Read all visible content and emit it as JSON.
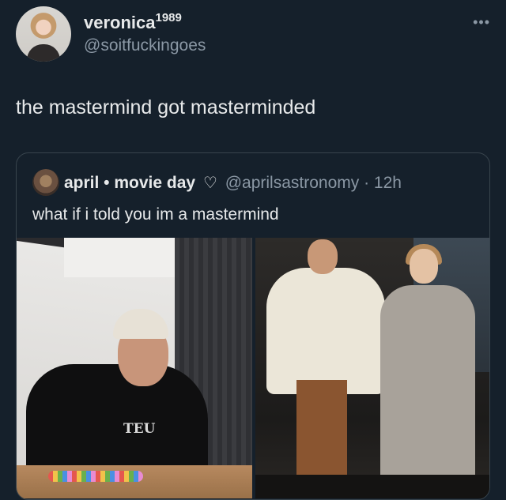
{
  "tweet": {
    "display_name": "veronica",
    "display_name_sup": "1989",
    "handle": "@soitfuckingoes",
    "more_icon": "more-horizontal-icon",
    "text": "the mastermind got masterminded"
  },
  "quoted": {
    "display_name": "april • movie day",
    "heart_icon": "heart-outline-icon",
    "handle_time": "@aprilsastronomy · 12h",
    "text": "what if i told you im a mastermind",
    "photo_labels": {
      "shirt_text": "TEU"
    }
  },
  "colors": {
    "background": "#15202b",
    "primary_text": "#e7e9ea",
    "secondary_text": "#8b98a5",
    "border": "#38444d"
  }
}
